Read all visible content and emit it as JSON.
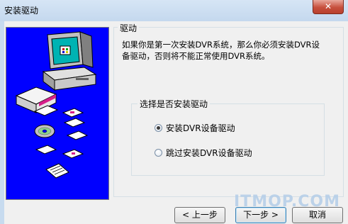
{
  "window": {
    "title": "安装驱动",
    "close_glyph": "✕"
  },
  "group_top": {
    "label": "驱动",
    "description": "如果你是第一次安装DVR系统，那么你必须安装DVR设备驱动，否则将不能正常使用DVR系统。"
  },
  "group_inner": {
    "label": "选择是否安装驱动",
    "options": [
      {
        "label": "安装DVR设备驱动",
        "checked": true
      },
      {
        "label": "跳过安装DVR设备驱动",
        "checked": false
      }
    ]
  },
  "buttons": {
    "back": "< 上一步",
    "next": "下一步 >",
    "cancel": "取消"
  },
  "watermark": "ITMOP.COM"
}
